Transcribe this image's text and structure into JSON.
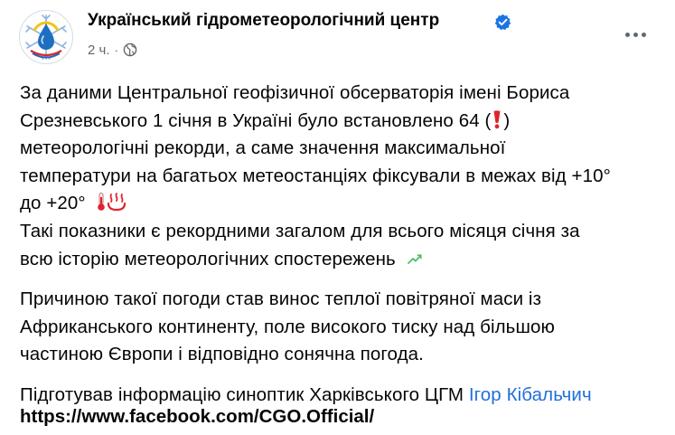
{
  "post": {
    "author": "Український гідрометеорологічний центр",
    "time": "2 ч.",
    "separator": "·",
    "verified_icon": "verified-badge-icon",
    "audience_icon": "globe-icon",
    "menu_icon": "more-horizontal-icon",
    "paragraph1": {
      "l1": "За даними Центральної геофізичної обсерваторія імені Бориса",
      "l2a": "Срезневського 1 січня в Україні було встановлено 64 (",
      "l2b": ")",
      "l3": "метеорологічні рекорди, а саме значення максимальної",
      "l4": "температури на багатьох метеостанціях фіксували в межах від +10°",
      "l5": "до +20°",
      "l6": "Такі показники є рекордними загалом для всього місяця січня за",
      "l7": "всю історію метеорологічних спостережень"
    },
    "paragraph2": {
      "l1": "Причиною такої погоди став винос теплої повітряної маси із",
      "l2": "Африканського континенту, поле високого тиску над більшою",
      "l3": "частиною Європи і відповідно сонячна погода."
    },
    "paragraph3": {
      "prefix": "Підготував інформацію синоптик Харківського ЦГМ",
      "person": "Ігор Кібальчич"
    },
    "url": "https://www.facebook.com/CGO.Official/",
    "emoji_icons": [
      "exclamation-icon",
      "thermometer-icon",
      "hot-springs-icon",
      "chart-increasing-icon"
    ],
    "colors": {
      "accent": "#1b74e4",
      "link": "#216fdb",
      "secondary_text": "#65676b",
      "emoji_red": "#e0242c"
    }
  }
}
